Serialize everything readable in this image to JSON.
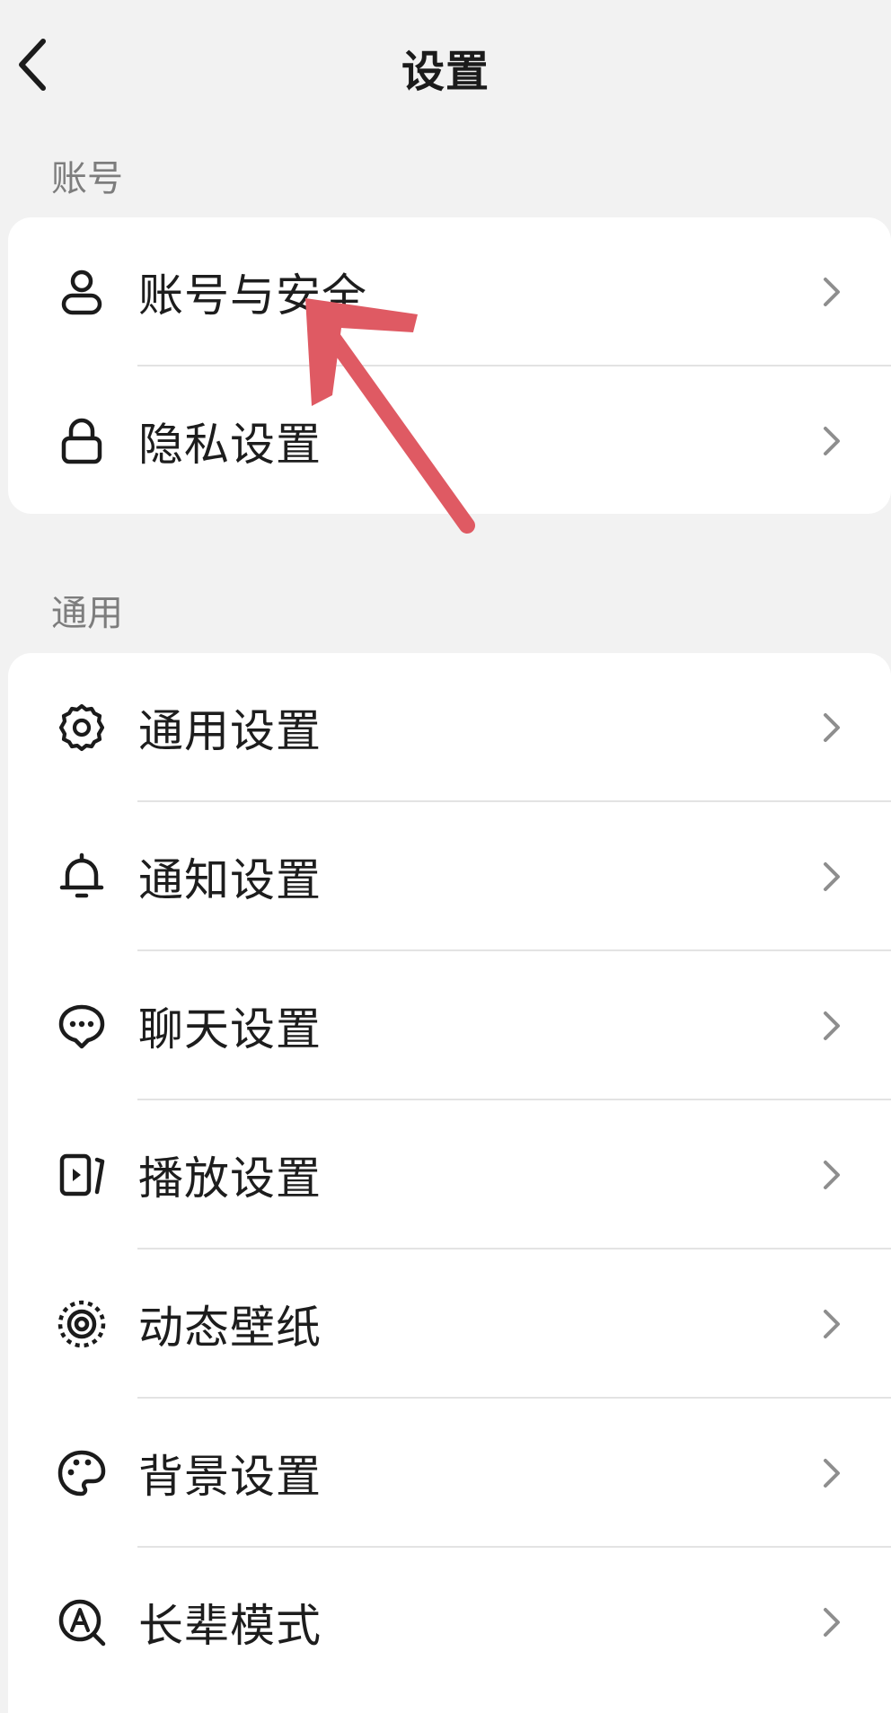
{
  "header": {
    "title": "设置",
    "back_icon": "chevron-left-icon"
  },
  "sections": {
    "account": {
      "label": "账号",
      "items": [
        {
          "label": "账号与安全",
          "icon": "user-icon"
        },
        {
          "label": "隐私设置",
          "icon": "lock-icon"
        }
      ]
    },
    "general": {
      "label": "通用",
      "items": [
        {
          "label": "通用设置",
          "icon": "gear-icon"
        },
        {
          "label": "通知设置",
          "icon": "bell-icon"
        },
        {
          "label": "聊天设置",
          "icon": "chat-bubble-icon"
        },
        {
          "label": "播放设置",
          "icon": "play-screen-icon"
        },
        {
          "label": "动态壁纸",
          "icon": "wallpaper-target-icon"
        },
        {
          "label": "背景设置",
          "icon": "palette-icon"
        },
        {
          "label": "长辈模式",
          "icon": "elder-mode-icon"
        }
      ]
    }
  },
  "colors": {
    "background": "#f2f2f2",
    "card": "#ffffff",
    "annotation_arrow": "#df5a63",
    "section_label": "#7d7d7d",
    "chevron": "#8e8e8e"
  }
}
